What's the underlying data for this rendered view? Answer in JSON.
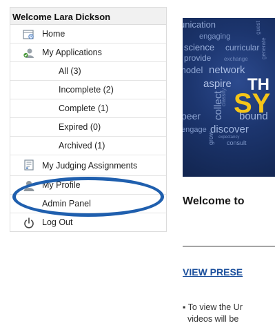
{
  "sidebar": {
    "header": "Welcome Lara Dickson",
    "items": [
      {
        "label": "Home",
        "icon": "home-icon"
      },
      {
        "label": "My Applications",
        "icon": "applications-icon"
      },
      {
        "label": "All (3)"
      },
      {
        "label": "Incomplete (2)"
      },
      {
        "label": "Complete (1)"
      },
      {
        "label": "Expired (0)"
      },
      {
        "label": "Archived (1)"
      },
      {
        "label": "My Judging Assignments",
        "icon": "judging-icon"
      },
      {
        "label": "My Profile",
        "icon": "profile-icon"
      },
      {
        "label": "Admin Panel"
      },
      {
        "label": "Log Out",
        "icon": "power-icon"
      }
    ]
  },
  "banner": {
    "words": [
      "unication",
      "engaging",
      "science",
      "curricular",
      "provide",
      "exchange",
      "model",
      "network",
      "aspire",
      "peer",
      "collect",
      "bound",
      "engage",
      "discover",
      "expectancy",
      "consult",
      "classify",
      "guest",
      "grow",
      "generate"
    ],
    "title_line1": "TH",
    "title_line2": "SY",
    "colors": {
      "background": "#1c356e",
      "word": "#8fa6d3",
      "title_white": "#ffffff",
      "title_yellow": "#f5c518"
    }
  },
  "main": {
    "welcome": "Welcome to",
    "view_link": "VIEW PRESE",
    "bullet_line1": "▪ To view the Ur",
    "bullet_line2": "  videos will be"
  },
  "colors": {
    "accent": "#1b4f9c",
    "highlight_ring": "#1f5fae"
  }
}
